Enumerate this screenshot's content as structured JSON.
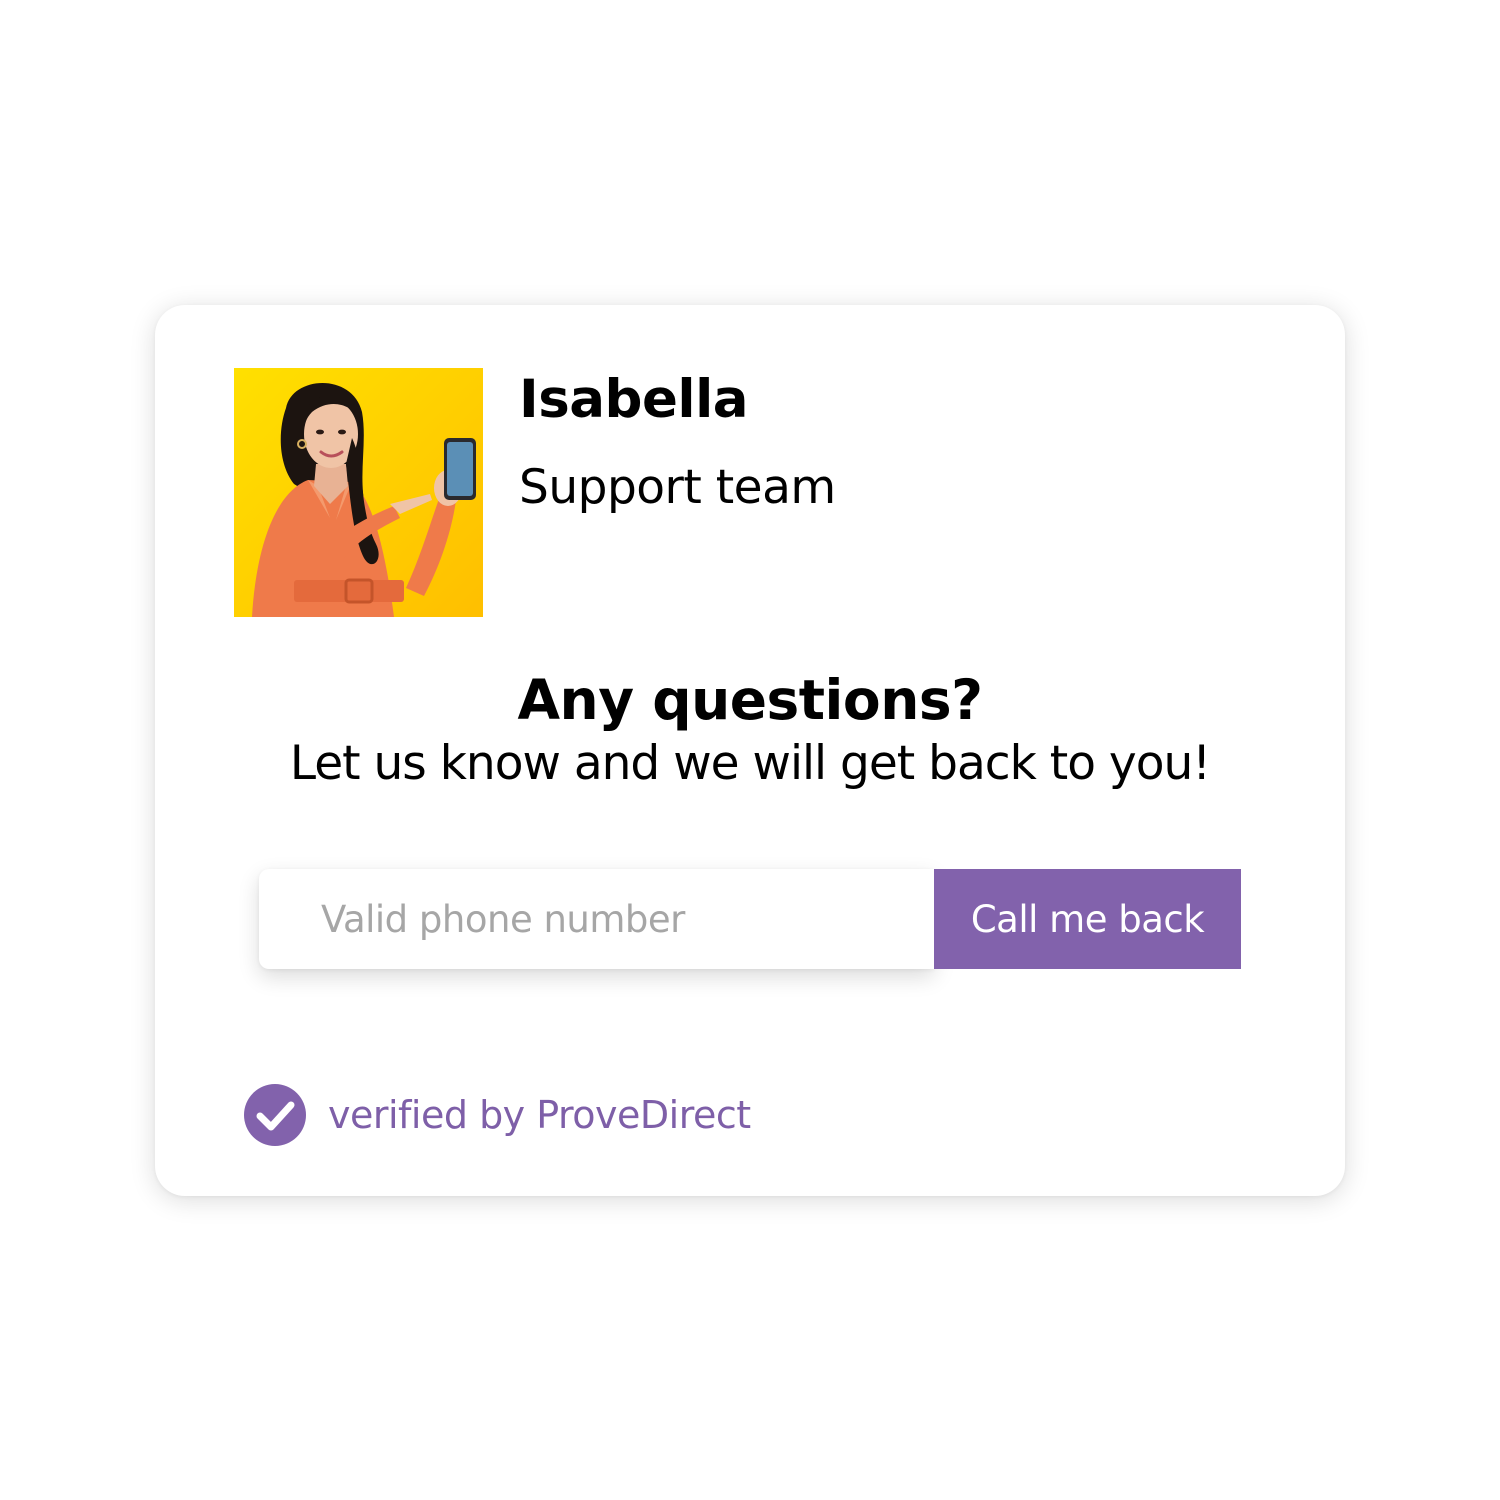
{
  "agent": {
    "name": "Isabella",
    "role": "Support team",
    "photo": "woman-pointing-at-phone-photo"
  },
  "prompt": {
    "headline": "Any questions?",
    "subline": "Let us know and we will get back to you!"
  },
  "form": {
    "phone_placeholder": "Valid phone number",
    "phone_value": "",
    "submit_label": "Call me back"
  },
  "badge": {
    "text": "verified by ProveDirect",
    "icon": "check-circle-icon"
  },
  "colors": {
    "accent": "#8262ac",
    "badge_text": "#7e5fa8",
    "photo_background": "#ffcc00",
    "placeholder": "#a6a6a6"
  }
}
